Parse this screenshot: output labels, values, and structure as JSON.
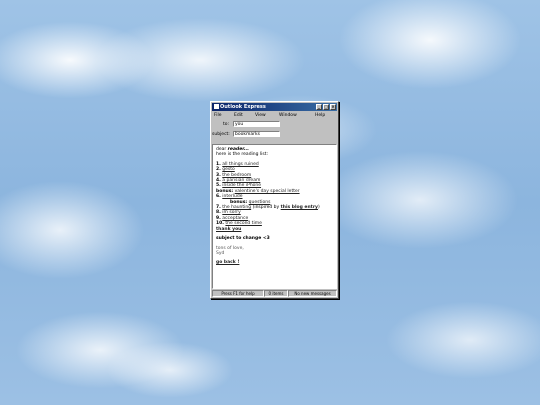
{
  "window": {
    "title": "Outlook Express",
    "controls": [
      "_",
      "□",
      "×"
    ]
  },
  "menu": [
    "File",
    "Edit",
    "View",
    "Window",
    "Help"
  ],
  "header": {
    "to_label": "to:",
    "to_value": "you",
    "subject_label": "subject:",
    "subject_value": "bookmarks"
  },
  "body": {
    "greeting_prefix": "dear ",
    "greeting_name": "reader...",
    "intro": "here is the reading list:",
    "items": [
      {
        "num": "1.",
        "text": "all things ruined"
      },
      {
        "num": "2.",
        "text": "gesto"
      },
      {
        "num": "3.",
        "text": "the bedroom"
      },
      {
        "num": "4.",
        "text": "a parisian dream"
      },
      {
        "num": "5.",
        "text": "inside the iPhone"
      }
    ],
    "bonus1": {
      "label": "bonus:",
      "text": "valentine's day special letter"
    },
    "item6": {
      "num": "6.",
      "text": "interlude"
    },
    "bonus2": {
      "label": "bonus:",
      "text": "questions"
    },
    "item7": {
      "num": "7.",
      "text": "the haunting",
      "suffix": " (inspired by ",
      "bold": "this blog entry",
      "close": ")"
    },
    "items_b": [
      {
        "num": "8.",
        "text": "im sorry"
      },
      {
        "num": "9.",
        "text": "acceptance"
      },
      {
        "num": "10.",
        "text": "the second time"
      }
    ],
    "thanks": "thank you",
    "change": "subject to change <3",
    "signoff": "tons of love,",
    "name": "Syd",
    "back": "go back !"
  },
  "status": [
    "Press F1 for help",
    "0 items",
    "No new messages"
  ]
}
